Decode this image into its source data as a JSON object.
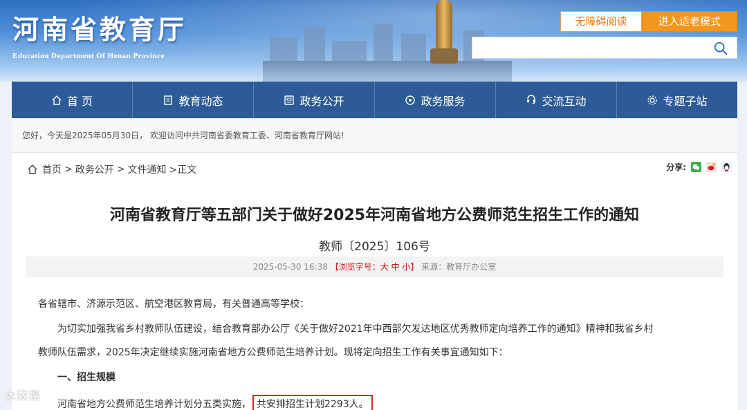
{
  "header": {
    "logo_cn": "河南省教育厅",
    "logo_en": "Education Department Of Henan Province",
    "accessible_label": "无障碍阅读",
    "elder_mode_label": "进入适老模式",
    "search_placeholder": ""
  },
  "nav": [
    {
      "label": "首 页",
      "icon": "home-icon"
    },
    {
      "label": "教育动态",
      "icon": "document-icon"
    },
    {
      "label": "政务公开",
      "icon": "notice-icon"
    },
    {
      "label": "政务服务",
      "icon": "service-icon"
    },
    {
      "label": "交流互动",
      "icon": "interaction-icon"
    },
    {
      "label": "专题子站",
      "icon": "gear-icon"
    }
  ],
  "welcome": "您好，今天是2025年05月30日， 欢迎访问中共河南省委教育工委、河南省教育厅网站!",
  "breadcrumb": {
    "home": "首页",
    "sep1": ">",
    "level1": "政务公开",
    "sep2": ">",
    "level2": "文件通知",
    "current": ">正文"
  },
  "share": {
    "label": "分享:",
    "icons": [
      "wechat-icon",
      "weibo-icon",
      "qq-icon"
    ]
  },
  "article": {
    "title": "河南省教育厅等五部门关于做好2025年河南省地方公费师范生招生工作的通知",
    "doc_no": "教师〔2025〕106号",
    "datetime": "2025-05-30 16:38",
    "font_size_label": "【浏览字号：",
    "font_size_options": "大 中 小",
    "font_size_close": "】",
    "source": "来源：教育厅办公室",
    "p1": "各省辖市、济源示范区、航空港区教育局，有关普通高等学校：",
    "p2": "为切实加强我省乡村教师队伍建设，结合教育部办公厅《关于做好2021年中西部欠发达地区优秀教师定向培养工作的通知》精神和我省乡村",
    "p3": "教师队伍需求，2025年决定继续实施河南省地方公费师范生培养计划。现将定向招生工作有关事宜通知如下：",
    "p4": "一、招生规模",
    "p5_prefix": "河南省地方公费师范生培养计划分五类实施，",
    "p5_highlight": "共安排招生计划2293人。"
  },
  "watermark": "大数据"
}
